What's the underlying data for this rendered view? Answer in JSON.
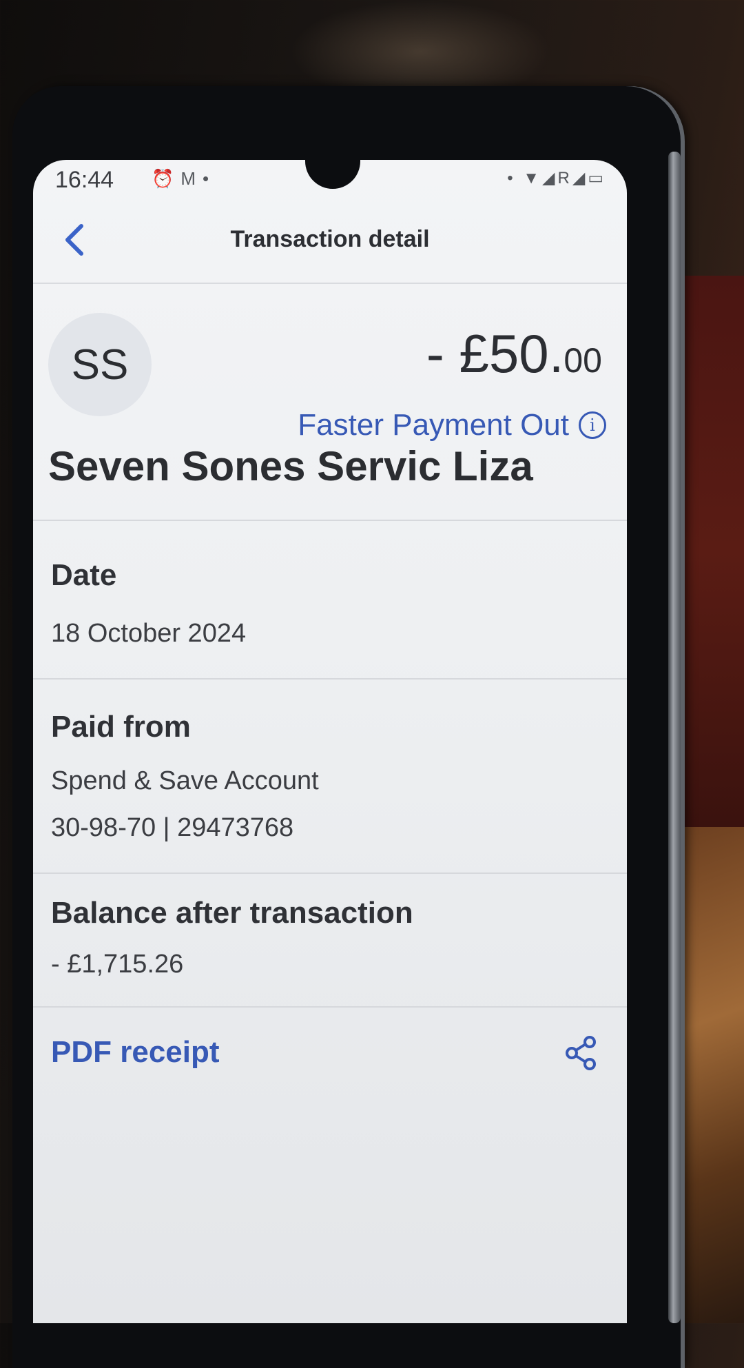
{
  "status_bar": {
    "time": "16:44",
    "left_icons": [
      "alarm-icon",
      "gmail-icon",
      "dot-icon"
    ],
    "right_icons": [
      "wifi-icon",
      "signal-icon",
      "roaming-r",
      "signal-icon-2",
      "battery-icon"
    ],
    "roaming_label": "R"
  },
  "header": {
    "title": "Transaction detail",
    "back_icon": "chevron-left-icon"
  },
  "transaction": {
    "avatar_initials": "SS",
    "amount_main": "- £50.",
    "amount_decimals": "00",
    "payment_type": "Faster Payment Out",
    "info_icon": "i",
    "payee": "Seven Sones Servic Liza"
  },
  "date": {
    "label": "Date",
    "value": "18 October 2024"
  },
  "paid_from": {
    "label": "Paid from",
    "account_name": "Spend & Save Account",
    "account_numbers": "30-98-70 | 29473768"
  },
  "balance": {
    "label": "Balance after transaction",
    "value": "- £1,715.26"
  },
  "receipt": {
    "label": "PDF receipt",
    "icon": "share-icon"
  },
  "colors": {
    "accent": "#3759b5",
    "text": "#2c2e33",
    "screen_bg": "#f1f2f4"
  }
}
